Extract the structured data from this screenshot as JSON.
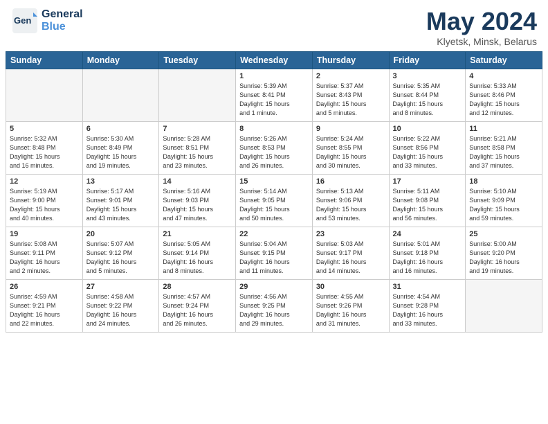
{
  "header": {
    "logo_line1": "General",
    "logo_line2": "Blue",
    "main_title": "May 2024",
    "subtitle": "Klyetsk, Minsk, Belarus"
  },
  "days_of_week": [
    "Sunday",
    "Monday",
    "Tuesday",
    "Wednesday",
    "Thursday",
    "Friday",
    "Saturday"
  ],
  "weeks": [
    [
      {
        "num": "",
        "info": "",
        "empty": true
      },
      {
        "num": "",
        "info": "",
        "empty": true
      },
      {
        "num": "",
        "info": "",
        "empty": true
      },
      {
        "num": "1",
        "info": "Sunrise: 5:39 AM\nSunset: 8:41 PM\nDaylight: 15 hours\nand 1 minute.",
        "empty": false
      },
      {
        "num": "2",
        "info": "Sunrise: 5:37 AM\nSunset: 8:43 PM\nDaylight: 15 hours\nand 5 minutes.",
        "empty": false
      },
      {
        "num": "3",
        "info": "Sunrise: 5:35 AM\nSunset: 8:44 PM\nDaylight: 15 hours\nand 8 minutes.",
        "empty": false
      },
      {
        "num": "4",
        "info": "Sunrise: 5:33 AM\nSunset: 8:46 PM\nDaylight: 15 hours\nand 12 minutes.",
        "empty": false
      }
    ],
    [
      {
        "num": "5",
        "info": "Sunrise: 5:32 AM\nSunset: 8:48 PM\nDaylight: 15 hours\nand 16 minutes.",
        "empty": false
      },
      {
        "num": "6",
        "info": "Sunrise: 5:30 AM\nSunset: 8:49 PM\nDaylight: 15 hours\nand 19 minutes.",
        "empty": false
      },
      {
        "num": "7",
        "info": "Sunrise: 5:28 AM\nSunset: 8:51 PM\nDaylight: 15 hours\nand 23 minutes.",
        "empty": false
      },
      {
        "num": "8",
        "info": "Sunrise: 5:26 AM\nSunset: 8:53 PM\nDaylight: 15 hours\nand 26 minutes.",
        "empty": false
      },
      {
        "num": "9",
        "info": "Sunrise: 5:24 AM\nSunset: 8:55 PM\nDaylight: 15 hours\nand 30 minutes.",
        "empty": false
      },
      {
        "num": "10",
        "info": "Sunrise: 5:22 AM\nSunset: 8:56 PM\nDaylight: 15 hours\nand 33 minutes.",
        "empty": false
      },
      {
        "num": "11",
        "info": "Sunrise: 5:21 AM\nSunset: 8:58 PM\nDaylight: 15 hours\nand 37 minutes.",
        "empty": false
      }
    ],
    [
      {
        "num": "12",
        "info": "Sunrise: 5:19 AM\nSunset: 9:00 PM\nDaylight: 15 hours\nand 40 minutes.",
        "empty": false
      },
      {
        "num": "13",
        "info": "Sunrise: 5:17 AM\nSunset: 9:01 PM\nDaylight: 15 hours\nand 43 minutes.",
        "empty": false
      },
      {
        "num": "14",
        "info": "Sunrise: 5:16 AM\nSunset: 9:03 PM\nDaylight: 15 hours\nand 47 minutes.",
        "empty": false
      },
      {
        "num": "15",
        "info": "Sunrise: 5:14 AM\nSunset: 9:05 PM\nDaylight: 15 hours\nand 50 minutes.",
        "empty": false
      },
      {
        "num": "16",
        "info": "Sunrise: 5:13 AM\nSunset: 9:06 PM\nDaylight: 15 hours\nand 53 minutes.",
        "empty": false
      },
      {
        "num": "17",
        "info": "Sunrise: 5:11 AM\nSunset: 9:08 PM\nDaylight: 15 hours\nand 56 minutes.",
        "empty": false
      },
      {
        "num": "18",
        "info": "Sunrise: 5:10 AM\nSunset: 9:09 PM\nDaylight: 15 hours\nand 59 minutes.",
        "empty": false
      }
    ],
    [
      {
        "num": "19",
        "info": "Sunrise: 5:08 AM\nSunset: 9:11 PM\nDaylight: 16 hours\nand 2 minutes.",
        "empty": false
      },
      {
        "num": "20",
        "info": "Sunrise: 5:07 AM\nSunset: 9:12 PM\nDaylight: 16 hours\nand 5 minutes.",
        "empty": false
      },
      {
        "num": "21",
        "info": "Sunrise: 5:05 AM\nSunset: 9:14 PM\nDaylight: 16 hours\nand 8 minutes.",
        "empty": false
      },
      {
        "num": "22",
        "info": "Sunrise: 5:04 AM\nSunset: 9:15 PM\nDaylight: 16 hours\nand 11 minutes.",
        "empty": false
      },
      {
        "num": "23",
        "info": "Sunrise: 5:03 AM\nSunset: 9:17 PM\nDaylight: 16 hours\nand 14 minutes.",
        "empty": false
      },
      {
        "num": "24",
        "info": "Sunrise: 5:01 AM\nSunset: 9:18 PM\nDaylight: 16 hours\nand 16 minutes.",
        "empty": false
      },
      {
        "num": "25",
        "info": "Sunrise: 5:00 AM\nSunset: 9:20 PM\nDaylight: 16 hours\nand 19 minutes.",
        "empty": false
      }
    ],
    [
      {
        "num": "26",
        "info": "Sunrise: 4:59 AM\nSunset: 9:21 PM\nDaylight: 16 hours\nand 22 minutes.",
        "empty": false
      },
      {
        "num": "27",
        "info": "Sunrise: 4:58 AM\nSunset: 9:22 PM\nDaylight: 16 hours\nand 24 minutes.",
        "empty": false
      },
      {
        "num": "28",
        "info": "Sunrise: 4:57 AM\nSunset: 9:24 PM\nDaylight: 16 hours\nand 26 minutes.",
        "empty": false
      },
      {
        "num": "29",
        "info": "Sunrise: 4:56 AM\nSunset: 9:25 PM\nDaylight: 16 hours\nand 29 minutes.",
        "empty": false
      },
      {
        "num": "30",
        "info": "Sunrise: 4:55 AM\nSunset: 9:26 PM\nDaylight: 16 hours\nand 31 minutes.",
        "empty": false
      },
      {
        "num": "31",
        "info": "Sunrise: 4:54 AM\nSunset: 9:28 PM\nDaylight: 16 hours\nand 33 minutes.",
        "empty": false
      },
      {
        "num": "",
        "info": "",
        "empty": true
      }
    ]
  ]
}
